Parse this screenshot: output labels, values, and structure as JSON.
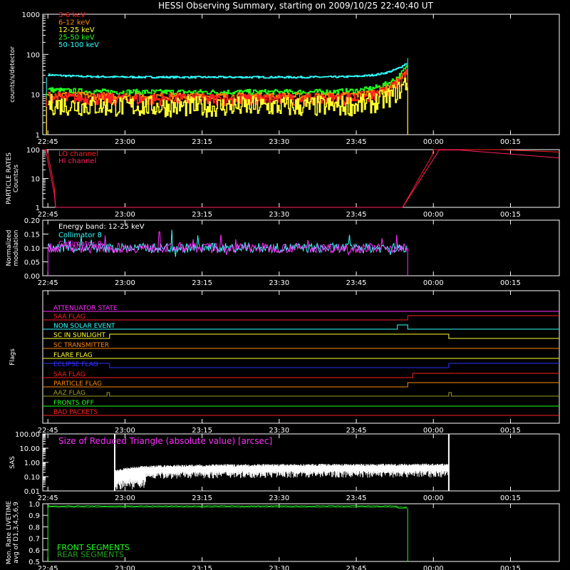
{
  "title": "HESSI Observing Summary, starting on 2009/10/25 22:40:40 UT",
  "time_ticks": [
    "22:45",
    "23:00",
    "23:15",
    "23:30",
    "23:45",
    "00:00",
    "00:15"
  ],
  "colors": {
    "red": "#ff2020",
    "orange": "#ff8800",
    "yellow": "#ffff30",
    "green": "#20ff20",
    "cyan": "#30ffff",
    "magenta": "#ff30ff",
    "crimson": "#ff2060",
    "blue": "#3030ff",
    "olive": "#a0a020",
    "white": "#ffffff",
    "darkgreen": "#20a020"
  },
  "chart_data": [
    {
      "type": "line",
      "id": "counts",
      "ylabel": "counts/s/detector",
      "ylim": [
        1,
        1000
      ],
      "scale": "log",
      "y_ticks": [
        "1",
        "10",
        "100",
        "1000"
      ],
      "legend": [
        "3-6 keV",
        "6-12 keV",
        "12-25 keV",
        "25-50 keV",
        "50-100 keV"
      ],
      "series": [
        {
          "name": "3-6 keV",
          "color": "red",
          "start": "22:45",
          "end": "23:55",
          "level": 7.5,
          "noise": 0.35
        },
        {
          "name": "6-12 keV",
          "color": "orange",
          "start": "22:45",
          "end": "23:55",
          "level": 9,
          "noise": 0.2
        },
        {
          "name": "12-25 keV",
          "color": "yellow",
          "start": "22:45",
          "end": "23:55",
          "level": 5,
          "noise": 0.6
        },
        {
          "name": "25-50 keV",
          "color": "green",
          "start": "22:45",
          "end": "23:55",
          "level": 11.5,
          "noise": 0.15
        },
        {
          "name": "50-100 keV",
          "color": "cyan",
          "start": "22:45",
          "end": "23:55",
          "level": 27,
          "noise": 0.05
        }
      ]
    },
    {
      "type": "line",
      "id": "particle",
      "ylabel_lines": [
        "PARTICLE RATES",
        "Counts/s"
      ],
      "ylim": [
        1,
        100
      ],
      "scale": "log",
      "y_ticks": [
        "1",
        "10",
        "100"
      ],
      "legend": [
        "LO channel",
        "HI channel"
      ],
      "series": [
        {
          "name": "LO channel",
          "color": "red",
          "start": "22:40",
          "end": "00:20"
        },
        {
          "name": "HI channel",
          "color": "crimson",
          "start": "22:40",
          "end": "00:20"
        }
      ]
    },
    {
      "type": "line",
      "id": "modulation",
      "ylabel_lines": [
        "Normalized",
        "modulation"
      ],
      "ylim": [
        0,
        0.2
      ],
      "y_ticks": [
        "0.00",
        "0.05",
        "0.10",
        "0.15",
        "0.20"
      ],
      "legend": [
        "Energy band: 12-25 keV",
        "Collimator 8",
        "Collimator 9"
      ],
      "series": [
        {
          "name": "Collimator 8",
          "color": "cyan",
          "start": "22:45",
          "end": "23:55",
          "level": 0.1
        },
        {
          "name": "Collimator 9",
          "color": "magenta",
          "start": "22:45",
          "end": "23:55",
          "level": 0.1
        }
      ]
    },
    {
      "type": "line",
      "id": "flags",
      "ylabel": "Flags",
      "flags": [
        {
          "name": "ATTENUATOR STATE",
          "color": "magenta"
        },
        {
          "name": "SAA FLAG",
          "color": "red"
        },
        {
          "name": "NON SOLAR EVENT",
          "color": "cyan"
        },
        {
          "name": "SC IN SUNLIGHT",
          "color": "yellow"
        },
        {
          "name": "SC TRANSMITTER",
          "color": "orange"
        },
        {
          "name": "FLARE FLAG",
          "color": "yellow"
        },
        {
          "name": "ECLIPSE FLAG",
          "color": "blue"
        },
        {
          "name": "SAA FLAG",
          "color": "red"
        },
        {
          "name": "PARTICLE FLAG",
          "color": "orange"
        },
        {
          "name": "AAZ FLAG",
          "color": "olive"
        },
        {
          "name": "FRONTS OFF",
          "color": "green"
        },
        {
          "name": "BAD PACKETS",
          "color": "red"
        }
      ]
    },
    {
      "type": "line",
      "id": "sas",
      "ylabel": "SAS",
      "annotation": "Size of Reduced Triangle (absolute value) [arcsec]",
      "ylim": [
        0.01,
        100
      ],
      "scale": "log",
      "y_ticks": [
        "0.01",
        "0.10",
        "1.00",
        "10.00",
        "100.00"
      ],
      "series": [
        {
          "name": "Size of Reduced Triangle",
          "color": "white",
          "start": "22:58",
          "end": "00:03"
        }
      ]
    },
    {
      "type": "line",
      "id": "livetime",
      "ylabel_lines": [
        "Mon. Rate LIVETIME",
        "avg of D1,3,4,5,6,9"
      ],
      "ylim": [
        0.5,
        1.0
      ],
      "y_ticks": [
        "0.5",
        "0.6",
        "0.7",
        "0.8",
        "0.9",
        "1.0"
      ],
      "legend": [
        "FRONT SEGMENTS",
        "REAR SEGMENTS"
      ],
      "series": [
        {
          "name": "FRONT SEGMENTS",
          "color": "green",
          "start": "22:45",
          "end": "23:55",
          "level": 0.98
        },
        {
          "name": "REAR SEGMENTS",
          "color": "darkgreen",
          "start": "22:45",
          "end": "23:55",
          "level": 0.97
        }
      ]
    }
  ]
}
